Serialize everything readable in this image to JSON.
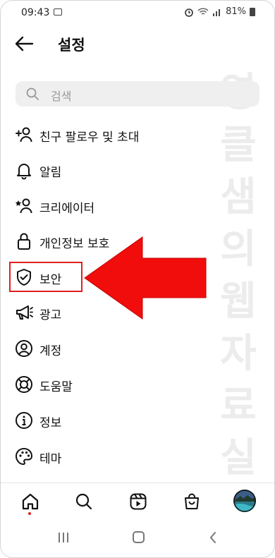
{
  "status_bar": {
    "time": "09:43",
    "battery_text": "81%"
  },
  "header": {
    "title": "설정"
  },
  "search": {
    "placeholder": "검색"
  },
  "menu": {
    "items": [
      {
        "label": "친구 팔로우 및 초대",
        "icon": "add-person-icon"
      },
      {
        "label": "알림",
        "icon": "bell-icon"
      },
      {
        "label": "크리에이터",
        "icon": "star-person-icon"
      },
      {
        "label": "개인정보 보호",
        "icon": "lock-icon"
      },
      {
        "label": "보안",
        "icon": "shield-check-icon"
      },
      {
        "label": "광고",
        "icon": "megaphone-icon"
      },
      {
        "label": "계정",
        "icon": "person-circle-icon"
      },
      {
        "label": "도움말",
        "icon": "lifebuoy-icon"
      },
      {
        "label": "정보",
        "icon": "info-icon"
      },
      {
        "label": "테마",
        "icon": "palette-icon"
      }
    ]
  },
  "watermark": "영클샘의웹자료실",
  "colors": {
    "accent_red": "#e0201f",
    "search_bg": "#efefef"
  }
}
